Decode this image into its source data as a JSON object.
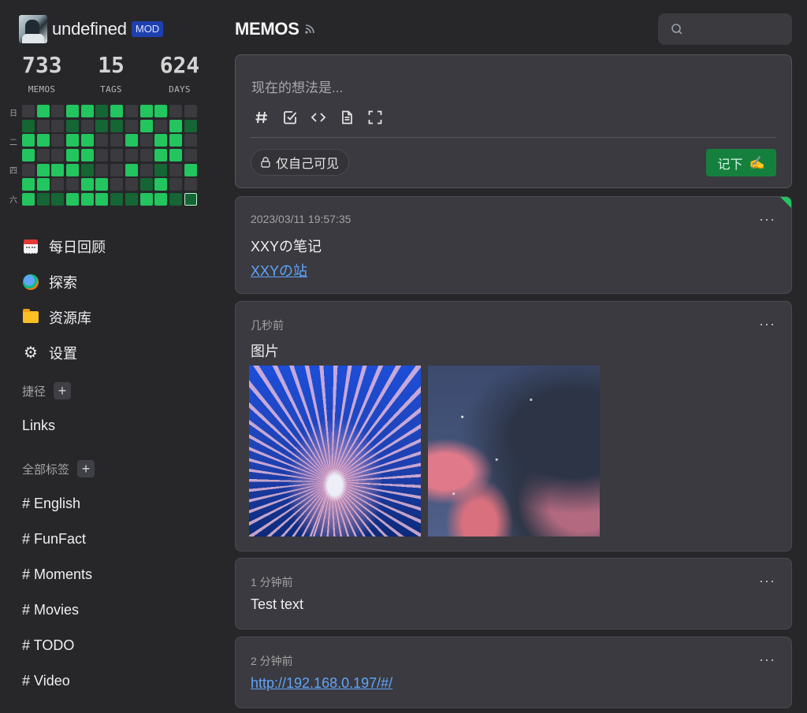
{
  "user": {
    "name": "undefined",
    "badge": "MOD"
  },
  "stats": [
    {
      "value": "733",
      "label": "MEMOS"
    },
    {
      "value": "15",
      "label": "TAGS"
    },
    {
      "value": "624",
      "label": "DAYS"
    }
  ],
  "heatmap": {
    "day_labels": [
      "日",
      "二",
      "四",
      "六"
    ],
    "rows": [
      [
        0,
        2,
        0,
        2,
        2,
        1,
        2,
        0,
        2,
        2,
        0,
        0
      ],
      [
        1,
        0,
        0,
        1,
        0,
        1,
        1,
        0,
        2,
        0,
        2,
        1
      ],
      [
        2,
        2,
        0,
        2,
        2,
        0,
        0,
        2,
        0,
        2,
        2,
        0
      ],
      [
        2,
        0,
        0,
        2,
        2,
        0,
        0,
        0,
        0,
        2,
        2,
        0
      ],
      [
        0,
        2,
        2,
        2,
        1,
        0,
        0,
        2,
        0,
        1,
        0,
        2
      ],
      [
        2,
        2,
        0,
        0,
        2,
        2,
        0,
        0,
        1,
        2,
        0,
        0
      ],
      [
        2,
        1,
        1,
        2,
        2,
        2,
        1,
        1,
        2,
        2,
        1,
        3
      ]
    ]
  },
  "nav": [
    {
      "label": "每日回顾",
      "icon": "daily-review-icon"
    },
    {
      "label": "探索",
      "icon": "explore-icon"
    },
    {
      "label": "资源库",
      "icon": "resources-folder-icon"
    },
    {
      "label": "设置",
      "icon": "settings-gear-icon"
    }
  ],
  "shortcuts": {
    "title": "捷径",
    "items": [
      "Links"
    ]
  },
  "tags": {
    "title": "全部标签",
    "items": [
      "# English",
      "# FunFact",
      "# Moments",
      "# Movies",
      "# TODO",
      "# Video"
    ]
  },
  "header": {
    "title": "MEMOS"
  },
  "search": {
    "placeholder": ""
  },
  "editor": {
    "placeholder": "现在的想法是...",
    "visibility": "仅自己可见",
    "save": "记下",
    "save_emoji": "✍️"
  },
  "memos": [
    {
      "time": "2023/03/11 19:57:35",
      "title": "XXYの笔记",
      "link": "XXYの站",
      "pinned": true
    },
    {
      "time": "几秒前",
      "title": "图片"
    },
    {
      "time": "1 分钟前",
      "title": "Test text"
    },
    {
      "time": "2 分钟前",
      "link": "http://192.168.0.197/#/"
    }
  ],
  "colors": {
    "accent": "#15803d",
    "heat_high": "#22c55e",
    "heat_mid": "#166534",
    "link": "#60a5fa",
    "badge": "#1e40af"
  }
}
